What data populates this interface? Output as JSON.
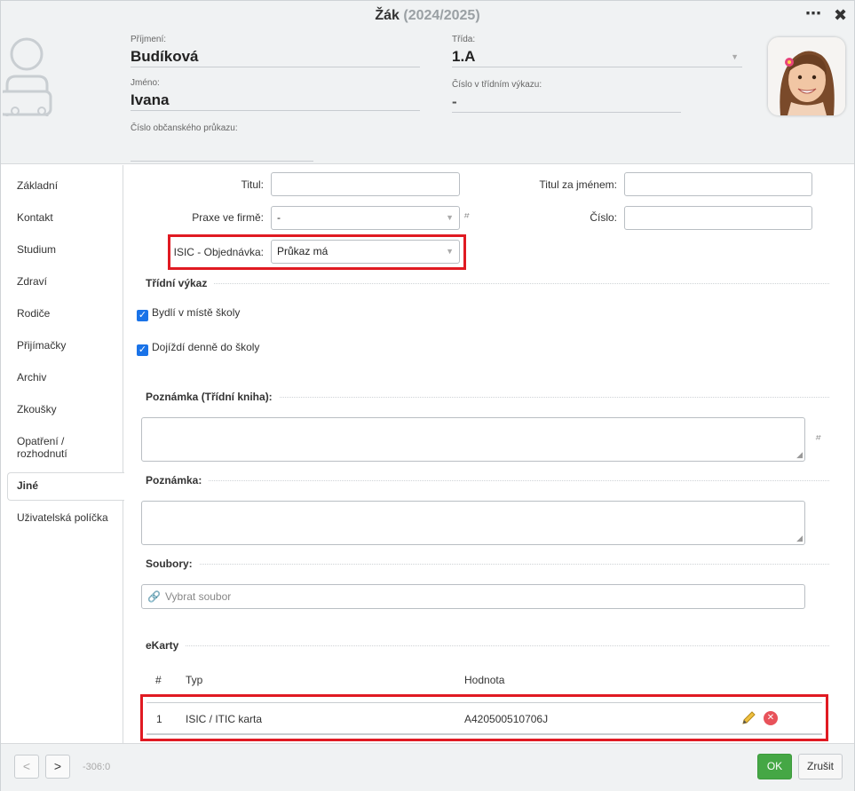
{
  "window": {
    "title": "Žák",
    "year": "(2024/2025)",
    "menu_icon": "ellipsis-icon",
    "close_icon": "close-icon"
  },
  "header": {
    "surname_label": "Příjmení:",
    "surname": "Budíková",
    "name_label": "Jméno:",
    "name": "Ivana",
    "id_card_label": "Číslo občanského průkazu:",
    "id_card": "",
    "class_label": "Třída:",
    "class": "1.A",
    "class_number_label": "Číslo v třídním výkazu:",
    "class_number": "-"
  },
  "sidebar": {
    "items": [
      {
        "label": "Základní"
      },
      {
        "label": "Kontakt"
      },
      {
        "label": "Studium"
      },
      {
        "label": "Zdraví"
      },
      {
        "label": "Rodiče"
      },
      {
        "label": "Přijímačky"
      },
      {
        "label": "Archiv"
      },
      {
        "label": "Zkoušky"
      },
      {
        "label": "Opatření /"
      },
      {
        "label": "Jiné"
      },
      {
        "label": "Uživatelská políčka"
      }
    ],
    "item8_line2": "rozhodnutí",
    "active": "Jiné"
  },
  "form": {
    "title_label": "Titul:",
    "title_value": "",
    "title_after_label": "Titul za jménem:",
    "title_after_value": "",
    "practice_label": "Praxe ve firmě:",
    "practice_value": "-",
    "number_label": "Číslo:",
    "number_value": "",
    "isic_label": "ISIC - Objednávka:",
    "isic_value": "Průkaz má",
    "hash": "⌗"
  },
  "class_report": {
    "title": "Třídní výkaz",
    "lives_in_school_place": "Bydlí v místě školy",
    "commutes_daily": "Dojíždí denně do školy"
  },
  "note_classbook": {
    "title": "Poznámka (Třídní kniha):"
  },
  "note": {
    "title": "Poznámka:"
  },
  "files": {
    "title": "Soubory:",
    "placeholder": "Vybrat soubor"
  },
  "ekarty": {
    "title": "eKarty",
    "headers": [
      "#",
      "Typ",
      "Hodnota"
    ],
    "rows": [
      {
        "num": "1",
        "type": "ISIC / ITIC karta",
        "value": "A420500510706J"
      }
    ]
  },
  "footer": {
    "prev": "<",
    "next": ">",
    "counter": "-306:0",
    "ok": "OK",
    "cancel": "Zrušit"
  },
  "colors": {
    "accent_red": "#e01a22",
    "ok_green": "#45a745",
    "checkbox_blue": "#1a73e8"
  }
}
